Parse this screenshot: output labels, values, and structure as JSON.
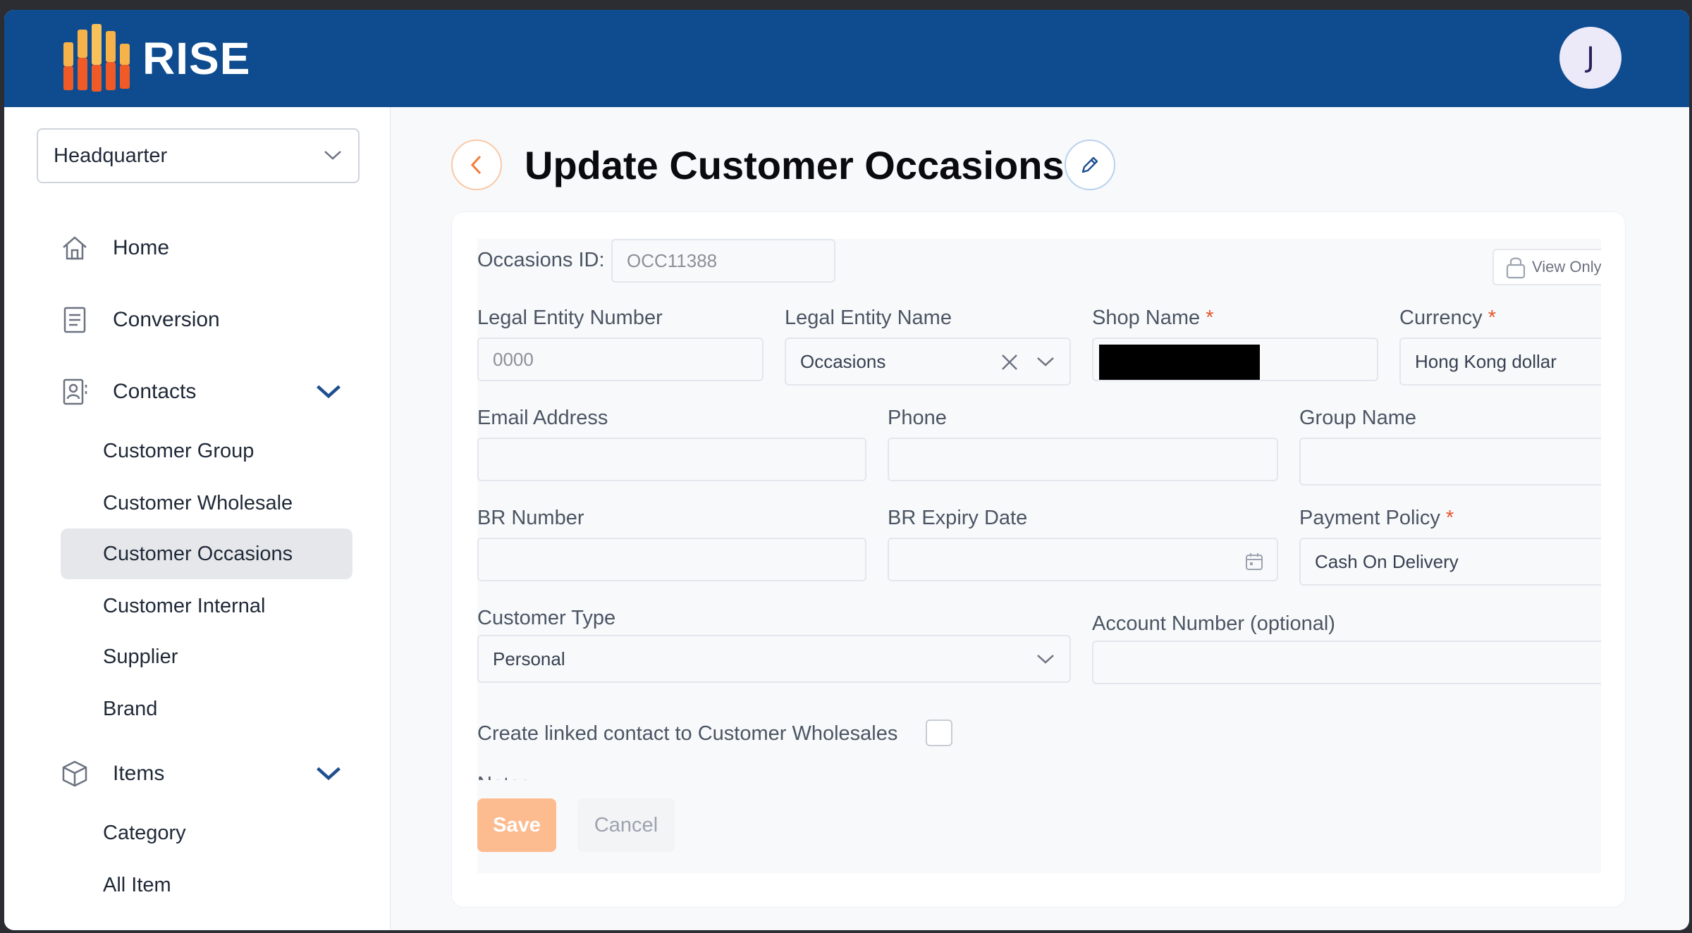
{
  "app": {
    "name": "RISE",
    "avatar_initial": "J"
  },
  "sidebar": {
    "branch": "Headquarter",
    "nav": {
      "home": "Home",
      "conversion": "Conversion",
      "contacts": "Contacts",
      "items": "Items"
    },
    "contacts_sub": [
      "Customer Group",
      "Customer Wholesale",
      "Customer Occasions",
      "Customer Internal",
      "Supplier",
      "Brand"
    ],
    "items_sub": [
      "Category",
      "All Item"
    ],
    "active_item": "Customer Occasions"
  },
  "page": {
    "title": "Update Customer Occasions"
  },
  "form": {
    "occasions_id_label": "Occasions ID:",
    "occasions_id_value": "OCC11388",
    "view_only_label": "View Only",
    "legal_entity_number_label": "Legal Entity Number",
    "legal_entity_number_placeholder": "0000",
    "legal_entity_name_label": "Legal Entity Name",
    "legal_entity_name_value": "Occasions",
    "shop_name_label": "Shop Name",
    "currency_label": "Currency",
    "currency_value": "Hong Kong dollar",
    "email_label": "Email Address",
    "phone_label": "Phone",
    "group_name_label": "Group Name",
    "br_number_label": "BR Number",
    "br_expiry_label": "BR Expiry Date",
    "payment_policy_label": "Payment Policy",
    "payment_policy_value": "Cash On Delivery",
    "customer_type_label": "Customer Type",
    "customer_type_value": "Personal",
    "account_number_label": "Account Number (optional)",
    "linked_contact_label": "Create linked contact to Customer Wholesales",
    "linked_contact_checked": false,
    "required_mark": "*",
    "partial_label": "Notes",
    "save_label": "Save",
    "cancel_label": "Cancel"
  },
  "colors": {
    "header": "#0f4c8f",
    "accent": "#f47b3a",
    "save_disabled": "#fdbb90",
    "required": "#e4572e"
  }
}
